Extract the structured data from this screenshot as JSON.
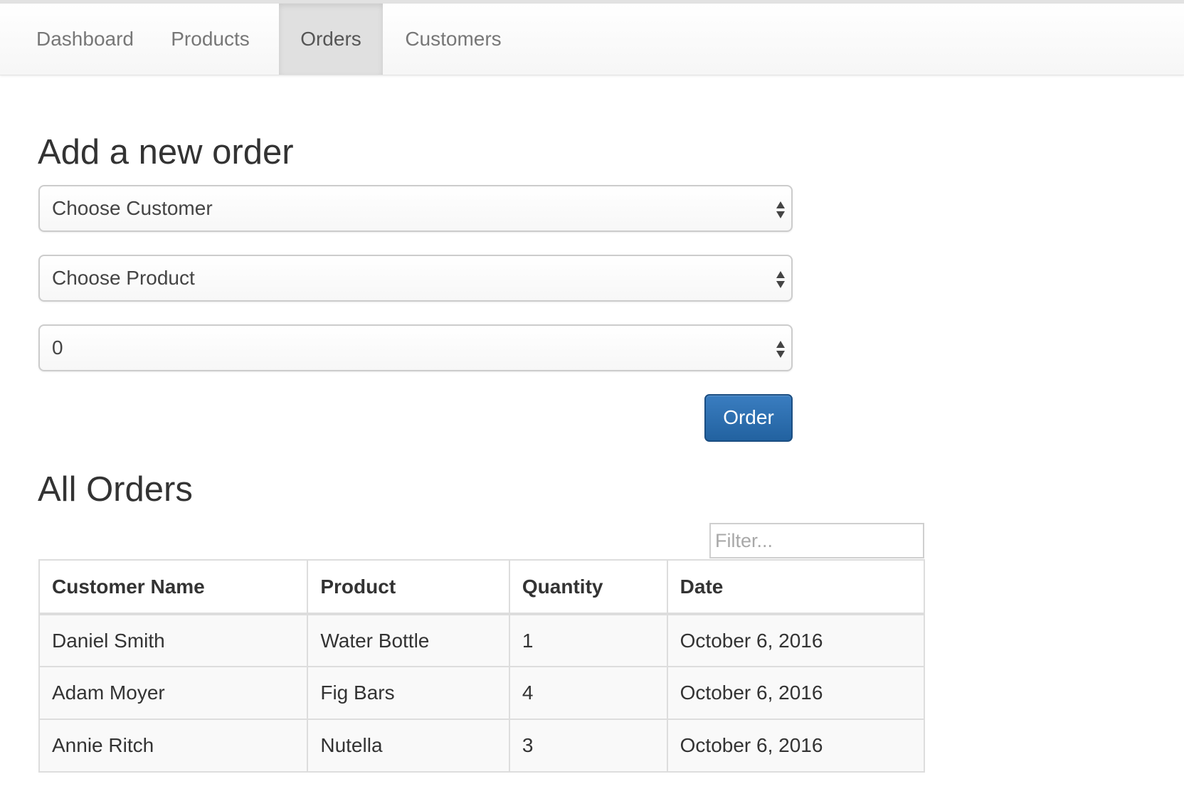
{
  "nav": {
    "items": [
      {
        "label": "Dashboard",
        "active": false
      },
      {
        "label": "Products",
        "active": false
      },
      {
        "label": "Orders",
        "active": true
      },
      {
        "label": "Customers",
        "active": false
      }
    ]
  },
  "add_order": {
    "heading": "Add a new order",
    "customer_select": "Choose Customer",
    "product_select": "Choose Product",
    "quantity_value": "0",
    "order_button": "Order"
  },
  "all_orders": {
    "heading": "All Orders",
    "filter_placeholder": "Filter...",
    "columns": [
      "Customer Name",
      "Product",
      "Quantity",
      "Date"
    ],
    "rows": [
      [
        "Daniel Smith",
        "Water Bottle",
        "1",
        "October 6, 2016"
      ],
      [
        "Adam Moyer",
        "Fig Bars",
        "4",
        "October 6, 2016"
      ],
      [
        "Annie Ritch",
        "Nutella",
        "3",
        "October 6, 2016"
      ]
    ]
  },
  "colors": {
    "primary_button": "#2262a0",
    "active_tab": "#e0e0e0"
  }
}
